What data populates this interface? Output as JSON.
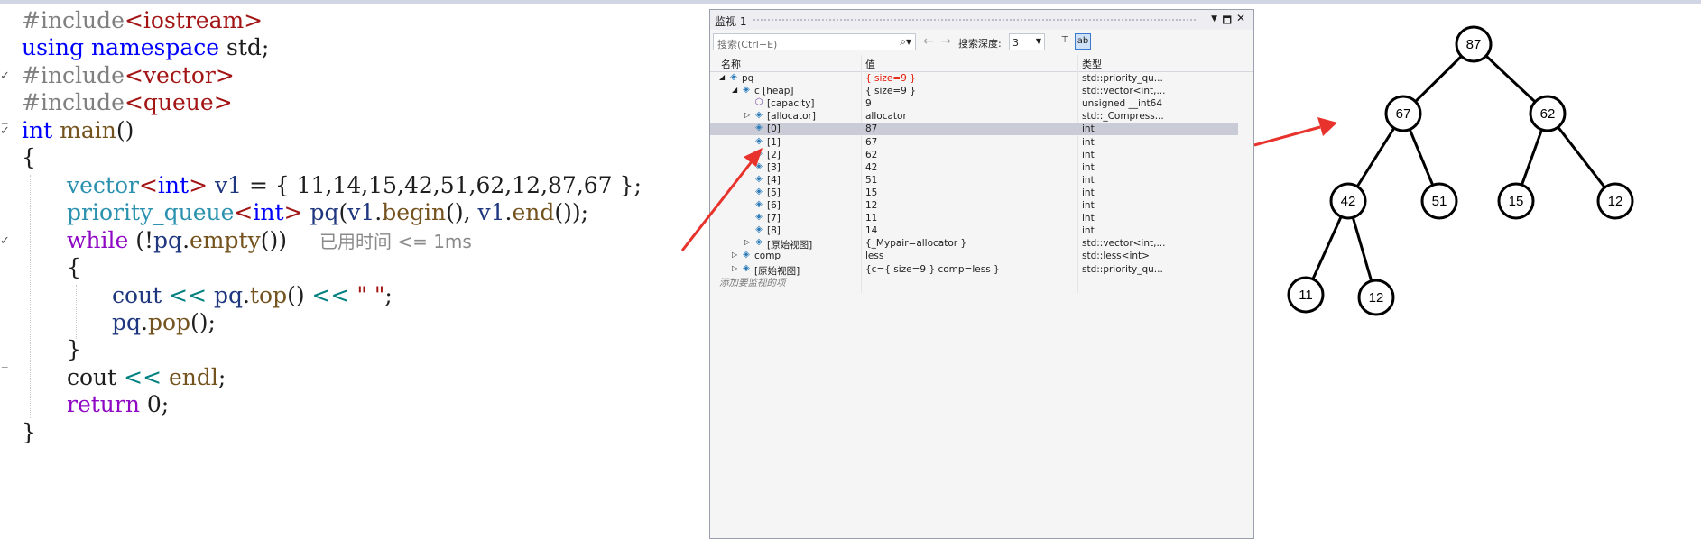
{
  "code": {
    "line1": {
      "directive": "#include",
      "header": "<iostream>"
    },
    "line2": {
      "using": "using",
      "namespace": "namespace",
      "name": "std;"
    },
    "line3": {
      "directive": "#include",
      "header": "<vector>"
    },
    "line4": {
      "directive": "#include",
      "header": "<queue>"
    },
    "line5": {
      "type": "int",
      "func": "main",
      "rest": "()"
    },
    "line6": {
      "text": "{"
    },
    "line7": {
      "type1": "vector",
      "lt": "<",
      "type2": "int",
      "gt": ">",
      "var": "v1",
      "rest": " = { 11,14,15,42,51,62,12,87,67 };"
    },
    "line8": {
      "type1": "priority_queue",
      "lt": "<",
      "type2": "int",
      "gt": ">",
      "var": "pq",
      "p1": "(",
      "var2": "v1",
      "dot1": ".",
      "f1": "begin",
      "p2": "(), ",
      "var3": "v1",
      "dot2": ".",
      "f2": "end",
      "p3": "());"
    },
    "line9": {
      "kw": "while",
      "p1": " (!",
      "var": "pq",
      "dot": ".",
      "f": "empty",
      "p2": "())",
      "hint": "已用时间 <= 1ms"
    },
    "line10": {
      "text": "{"
    },
    "line11": {
      "var": "cout",
      "op1": " << ",
      "var2": "pq",
      "dot": ".",
      "f": "top",
      "p": "() ",
      "op2": "<<",
      "str": " \" \"",
      "end": ";"
    },
    "line12": {
      "var": "pq",
      "dot": ".",
      "f": "pop",
      "p": "();"
    },
    "line13": {
      "text": "}"
    },
    "line14": {
      "var": "cout",
      "op": " << ",
      "f": "endl",
      "end": ";"
    },
    "line15": {
      "kw": "return",
      "rest": " 0;"
    },
    "line16": {
      "text": "}"
    }
  },
  "watch": {
    "title": "监视 1",
    "search_placeholder": "搜索(Ctrl+E)",
    "search_icon": "search-icon",
    "depth_label": "搜索深度:",
    "depth_value": "3",
    "columns": {
      "name": "名称",
      "value": "值",
      "type": "类型"
    },
    "rows": [
      {
        "name": "pq",
        "value": "{ size=9 }",
        "type": "std::priority_qu...",
        "value_changed": true
      },
      {
        "name": "c [heap]",
        "value": "{ size=9 }",
        "type": "std::vector<int,..."
      },
      {
        "name": "[capacity]",
        "value": "9",
        "type": "unsigned __int64"
      },
      {
        "name": "[allocator]",
        "value": "allocator",
        "type": "std::_Compress..."
      },
      {
        "name": "[0]",
        "value": "87",
        "type": "int"
      },
      {
        "name": "[1]",
        "value": "67",
        "type": "int"
      },
      {
        "name": "[2]",
        "value": "62",
        "type": "int"
      },
      {
        "name": "[3]",
        "value": "42",
        "type": "int"
      },
      {
        "name": "[4]",
        "value": "51",
        "type": "int"
      },
      {
        "name": "[5]",
        "value": "15",
        "type": "int"
      },
      {
        "name": "[6]",
        "value": "12",
        "type": "int"
      },
      {
        "name": "[7]",
        "value": "11",
        "type": "int"
      },
      {
        "name": "[8]",
        "value": "14",
        "type": "int"
      },
      {
        "name": "[原始视图]",
        "value": "{_Mypair=allocator }",
        "type": "std::vector<int,..."
      },
      {
        "name": "comp",
        "value": "less",
        "type": "std::less<int>"
      },
      {
        "name": "[原始视图]",
        "value": "{c={ size=9 } comp=less }",
        "type": "std::priority_qu..."
      }
    ],
    "add_watch": "添加要监视的项"
  },
  "tree": {
    "nodes": [
      "87",
      "67",
      "62",
      "42",
      "51",
      "15",
      "12",
      "11",
      "12"
    ]
  },
  "colors": {
    "keyword": "#0000ff",
    "type": "#2b91af",
    "preprocessor": "#808080",
    "header": "#a31515",
    "arrow": "#e8322c",
    "selected_row": "#c9ccd7"
  }
}
